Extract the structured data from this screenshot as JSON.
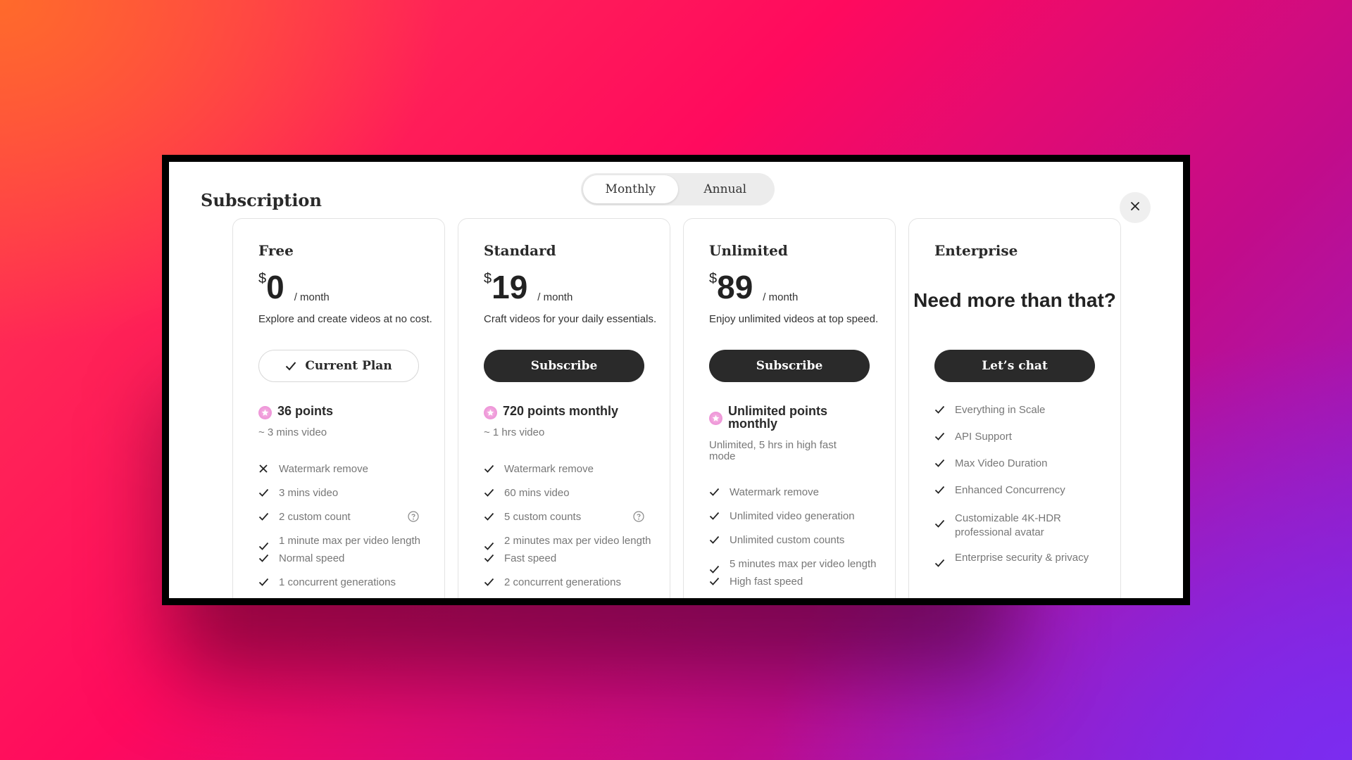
{
  "modal": {
    "title": "Subscription",
    "billing_toggle": {
      "monthly": "Monthly",
      "annual": "Annual",
      "selected": "Monthly"
    }
  },
  "plans": [
    {
      "name": "Free",
      "currency": "$",
      "price": "0",
      "period": "/ month",
      "description": "Explore and create videos at no cost.",
      "button": "Current Plan",
      "points": "36 points",
      "points_sub": "~ 3 mins video",
      "features": [
        {
          "text": "Watermark remove",
          "included": false
        },
        {
          "text": "3 mins video",
          "included": true
        },
        {
          "text": "2 custom count",
          "included": true,
          "help": true
        },
        {
          "text": "1 minute max per video length",
          "included": true
        },
        {
          "text": "Normal speed",
          "included": true
        },
        {
          "text": "1 concurrent generations",
          "included": true
        }
      ]
    },
    {
      "name": "Standard",
      "currency": "$",
      "price": "19",
      "period": "/ month",
      "description": "Craft videos for your daily essentials.",
      "button": "Subscribe",
      "points": "720 points monthly",
      "points_sub": "~ 1 hrs video",
      "features": [
        {
          "text": "Watermark remove",
          "included": true
        },
        {
          "text": "60 mins video",
          "included": true
        },
        {
          "text": "5 custom counts",
          "included": true,
          "help": true
        },
        {
          "text": "2 minutes max per video length",
          "included": true
        },
        {
          "text": "Fast speed",
          "included": true
        },
        {
          "text": "2 concurrent generations",
          "included": true
        }
      ]
    },
    {
      "name": "Unlimited",
      "currency": "$",
      "price": "89",
      "period": "/ month",
      "description": "Enjoy unlimited videos at top speed.",
      "button": "Subscribe",
      "points": "Unlimited points monthly",
      "points_sub": "Unlimited, 5 hrs in high fast mode",
      "features": [
        {
          "text": "Watermark remove",
          "included": true
        },
        {
          "text": "Unlimited video generation",
          "included": true
        },
        {
          "text": "Unlimited custom counts",
          "included": true
        },
        {
          "text": "5 minutes max per video length",
          "included": true
        },
        {
          "text": "High fast speed",
          "included": true
        }
      ]
    },
    {
      "name": "Enterprise",
      "headline": "Need more than that?",
      "button": "Let’s chat",
      "features": [
        {
          "text": "Everything in Scale",
          "included": true
        },
        {
          "text": "API Support",
          "included": true
        },
        {
          "text": "Max Video Duration",
          "included": true
        },
        {
          "text": "Enhanced Concurrency",
          "included": true
        },
        {
          "text": "Customizable 4K-HDR professional avatar",
          "included": true
        },
        {
          "text": "Enterprise security & privacy",
          "included": true
        }
      ]
    }
  ]
}
